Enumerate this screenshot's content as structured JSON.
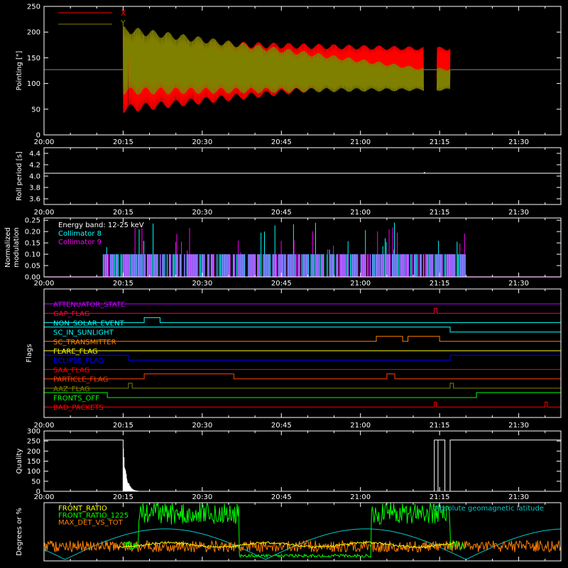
{
  "time_ticks": [
    "20:00",
    "20:15",
    "20:30",
    "20:45",
    "21:00",
    "21:15",
    "21:30"
  ],
  "colors": {
    "background": "#000000",
    "axis": "#ffffff",
    "x_series": "#ff0000",
    "y_series": "#808000",
    "collimator8": "#00ffff",
    "collimator9": "#ff00ff",
    "front_ratio": "#ffff00",
    "front_ratio_1225": "#00ff00",
    "max_det_vs_tot": "#ff8000",
    "geomagnetic": "#00c8c8"
  },
  "chart_data": [
    {
      "type": "line",
      "ylabel": "Pointing [\"]",
      "ylim": [
        0,
        250
      ],
      "yticks": [
        "0",
        "50",
        "100",
        "150",
        "200",
        "250"
      ],
      "x_range": [
        "20:00",
        "21:38"
      ],
      "series": [
        {
          "name": "X",
          "color": "#ff0000",
          "start": "20:15",
          "end": "21:12",
          "center_start": 115,
          "center_end": 140,
          "amp_start": 65,
          "amp_end": 28
        },
        {
          "name": "Y",
          "color": "#808000",
          "start": "20:15",
          "end": "21:12",
          "center_start": 145,
          "center_end": 108,
          "amp_start": 60,
          "amp_end": 20
        }
      ],
      "reference_line": 127,
      "legend_placement": "top-left"
    },
    {
      "type": "line",
      "ylabel": "Roll period [s]",
      "ylim": [
        3.5,
        4.5
      ],
      "yticks": [
        "3.6",
        "3.8",
        "4.0",
        "4.2",
        "4.4"
      ],
      "series": [
        {
          "name": "roll",
          "value": 4.05
        }
      ]
    },
    {
      "type": "bar",
      "ylabel": "Normalized modulation",
      "ylim": [
        0,
        0.26
      ],
      "yticks": [
        "0.00",
        "0.05",
        "0.10",
        "0.15",
        "0.20",
        "0.25"
      ],
      "annotation": "Energy band: 12-25 keV",
      "series": [
        {
          "name": "Collimator 8",
          "color": "#00ffff",
          "start": "20:11",
          "end": "21:20",
          "base": 0.1
        },
        {
          "name": "Collimator 9",
          "color": "#ff00ff",
          "start": "20:11",
          "end": "21:20",
          "base": 0.1
        }
      ]
    },
    {
      "type": "step",
      "ylabel": "Flags",
      "flags": [
        {
          "name": "ATTENUATOR_STATE",
          "color": "#c000ff",
          "segments": []
        },
        {
          "name": "GAP_FLAG",
          "color": "#ff0040",
          "segments": [
            [
              "21:14",
              "21:14.5"
            ]
          ]
        },
        {
          "name": "NON_SOLAR_EVENT",
          "color": "#00ffff",
          "segments": [
            [
              "20:19",
              "20:22"
            ]
          ]
        },
        {
          "name": "SC_IN_SUNLIGHT",
          "color": "#00ffff",
          "segments": [
            [
              "20:00",
              "21:17"
            ]
          ]
        },
        {
          "name": "SC_TRANSMITTER",
          "color": "#ff8000",
          "segments": [
            [
              "21:03",
              "21:08"
            ],
            [
              "21:09",
              "21:15"
            ]
          ]
        },
        {
          "name": "FLARE_FLAG",
          "color": "#ffff00",
          "segments": []
        },
        {
          "name": "ECLIPSE_FLAG",
          "color": "#0000ff",
          "segments": [
            [
              "20:00",
              "20:16"
            ],
            [
              "21:17",
              "21:38"
            ]
          ]
        },
        {
          "name": "SAA_FLAG",
          "color": "#ff0000",
          "segments": []
        },
        {
          "name": "PARTICLE_FLAG",
          "color": "#ff4000",
          "segments": [
            [
              "20:19",
              "20:36"
            ],
            [
              "21:05",
              "21:06.5"
            ]
          ]
        },
        {
          "name": "AAZ_FLAG",
          "color": "#808000",
          "segments": [
            [
              "20:16",
              "20:16.7"
            ],
            [
              "21:17",
              "21:17.6"
            ]
          ]
        },
        {
          "name": "FRONTS_OFF",
          "color": "#00ff00",
          "segments": [
            [
              "20:00",
              "20:12"
            ],
            [
              "21:22",
              "21:38"
            ]
          ]
        },
        {
          "name": "BAD_PACKETS",
          "color": "#ff0000",
          "segments": [
            [
              "21:14",
              "21:14.4"
            ],
            [
              "21:35",
              "21:35.4"
            ]
          ]
        }
      ]
    },
    {
      "type": "line",
      "ylabel": "Quality",
      "ylim": [
        0,
        300
      ],
      "yticks": [
        "0",
        "50",
        "100",
        "150",
        "200",
        "250",
        "300"
      ],
      "series": [
        {
          "name": "quality",
          "color": "#ffffff",
          "high": 255,
          "segments_high": [
            [
              "20:00",
              "20:15"
            ],
            [
              "21:14",
              "21:16"
            ],
            [
              "21:17",
              "21:38"
            ]
          ]
        }
      ]
    },
    {
      "type": "line",
      "ylabel": "Degrees or %",
      "ylim": [
        0,
        80
      ],
      "series": [
        {
          "name": "FRONT_RATIO",
          "color": "#ffff00"
        },
        {
          "name": "FRONT_RATIO_1225",
          "color": "#00ff00"
        },
        {
          "name": "MAX_DET_VS_TOT",
          "color": "#ff8000"
        },
        {
          "name": "Absolute geomagnetic latitude",
          "color": "#00c8c8"
        }
      ]
    }
  ]
}
